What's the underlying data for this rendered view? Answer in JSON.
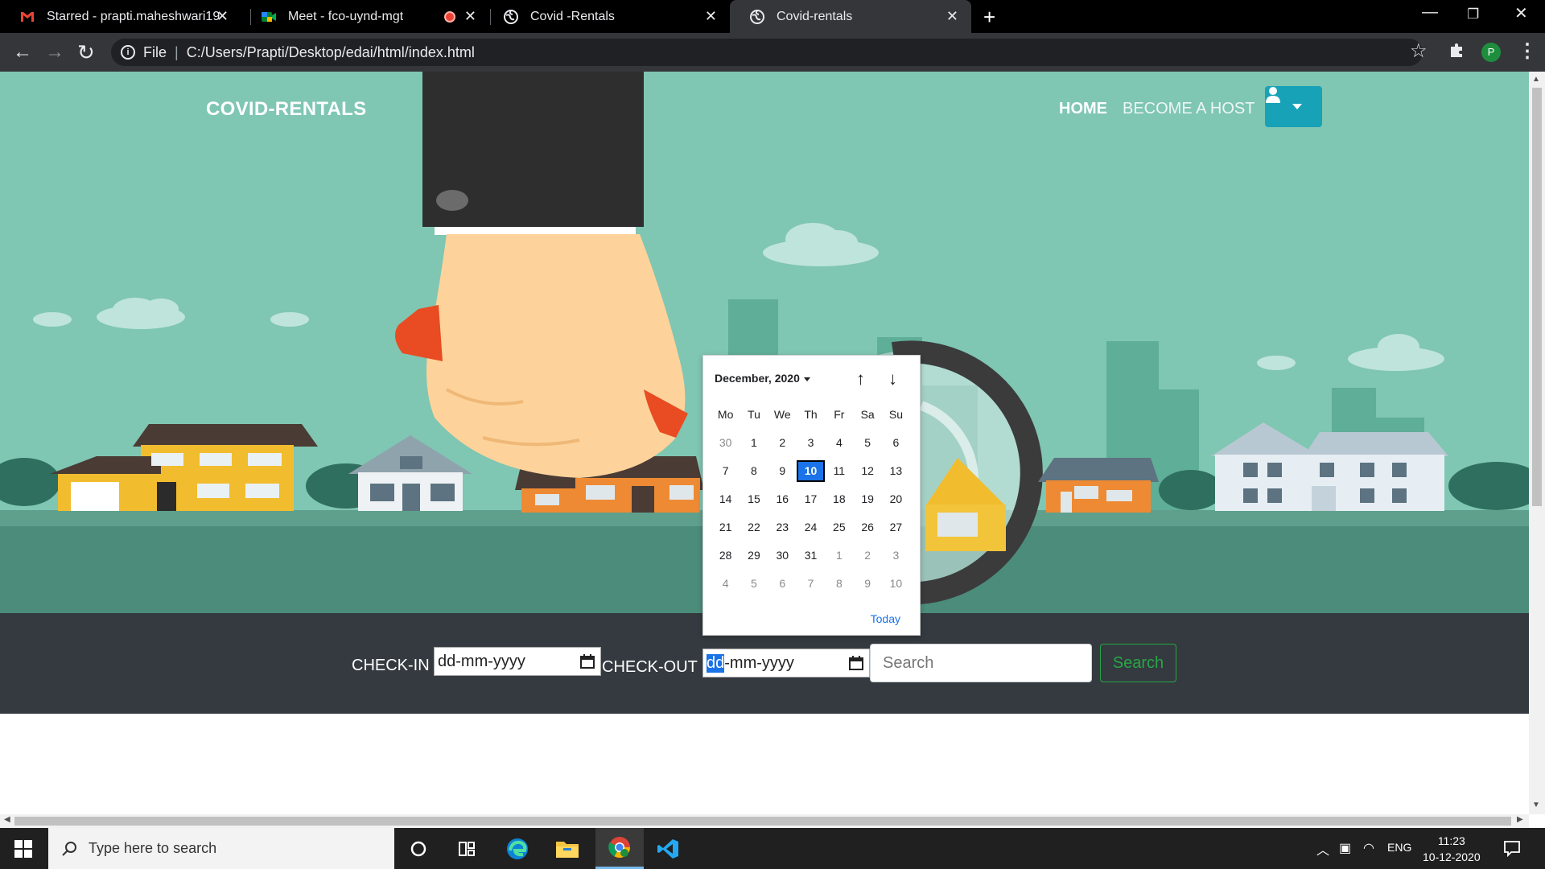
{
  "browser": {
    "tabs": [
      {
        "label": "Starred - prapti.maheshwari19@",
        "icon": "gmail-icon",
        "active": false
      },
      {
        "label": "Meet - fco-uynd-mgt",
        "icon": "meet-icon",
        "active": false
      },
      {
        "label": "Covid -Rentals",
        "icon": "globe-icon",
        "active": false
      },
      {
        "label": "Covid-rentals",
        "icon": "globe-icon",
        "active": true
      }
    ],
    "url_scheme": "File",
    "url": "C:/Users/Prapti/Desktop/edai/html/index.html",
    "profile_initial": "P"
  },
  "page": {
    "brand": "COVID-RENTALS",
    "nav": {
      "home": "HOME",
      "host": "BECOME A HOST"
    },
    "colors": {
      "hero": "#7fc6b3",
      "bar": "#343a40",
      "accent": "#17a2b8",
      "success": "#28a745",
      "picker_selected": "#1a73e8"
    },
    "search": {
      "checkin_label": "CHECK-IN",
      "checkout_label": "CHECK-OUT",
      "checkin_value": "dd-mm-yyyy",
      "checkout_dd": "dd",
      "checkout_rest": "-mm-yyyy",
      "placeholder": "Search",
      "button": "Search"
    }
  },
  "datepicker": {
    "month": "December, 2020",
    "weekdays": [
      "Mo",
      "Tu",
      "We",
      "Th",
      "Fr",
      "Sa",
      "Su"
    ],
    "weeks": [
      [
        "30",
        "1",
        "2",
        "3",
        "4",
        "5",
        "6"
      ],
      [
        "7",
        "8",
        "9",
        "10",
        "11",
        "12",
        "13"
      ],
      [
        "14",
        "15",
        "16",
        "17",
        "18",
        "19",
        "20"
      ],
      [
        "21",
        "22",
        "23",
        "24",
        "25",
        "26",
        "27"
      ],
      [
        "28",
        "29",
        "30",
        "31",
        "1",
        "2",
        "3"
      ],
      [
        "4",
        "5",
        "6",
        "7",
        "8",
        "9",
        "10"
      ]
    ],
    "muted": [
      [
        0,
        0
      ],
      [
        4,
        4
      ],
      [
        4,
        5
      ],
      [
        4,
        6
      ],
      [
        5,
        0
      ],
      [
        5,
        1
      ],
      [
        5,
        2
      ],
      [
        5,
        3
      ],
      [
        5,
        4
      ],
      [
        5,
        5
      ],
      [
        5,
        6
      ]
    ],
    "selected": [
      1,
      3
    ],
    "today": "Today"
  },
  "taskbar": {
    "search_placeholder": "Type here to search",
    "lang": "ENG",
    "time": "11:23",
    "date": "10-12-2020"
  }
}
